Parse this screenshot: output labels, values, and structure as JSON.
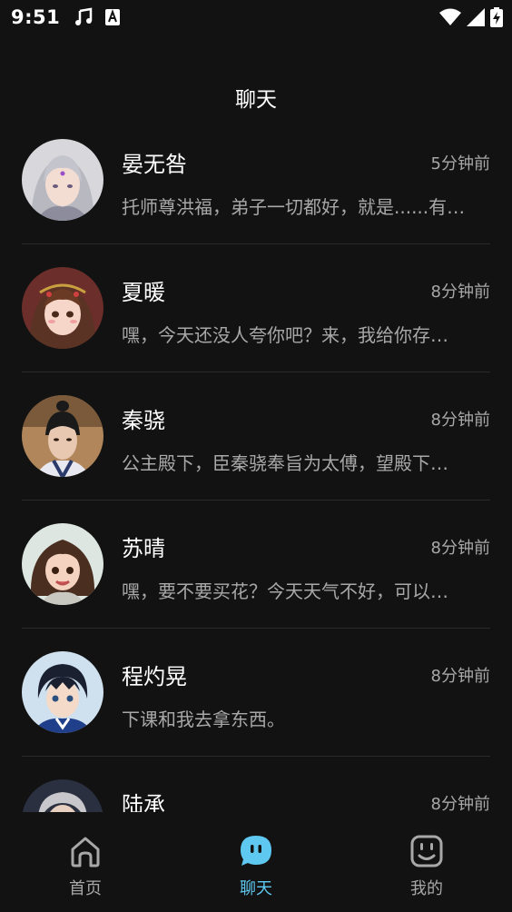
{
  "status": {
    "time": "9:51",
    "icons": [
      "music-note-icon",
      "a-notification-icon",
      "wifi-icon",
      "signal-icon",
      "battery-charging-icon"
    ]
  },
  "page": {
    "title": "聊天"
  },
  "chats": [
    {
      "name": "晏无咎",
      "time": "5分钟前",
      "preview": "托师尊洪福，弟子一切都好，就是......有…"
    },
    {
      "name": "夏暖",
      "time": "8分钟前",
      "preview": "嘿，今天还没人夸你吧？来，我给你存…"
    },
    {
      "name": "秦骁",
      "time": "8分钟前",
      "preview": "公主殿下，臣秦骁奉旨为太傅，望殿下…"
    },
    {
      "name": "苏晴",
      "time": "8分钟前",
      "preview": "嘿，要不要买花？今天天气不好，可以…"
    },
    {
      "name": "程灼晃",
      "time": "8分钟前",
      "preview": "下课和我去拿东西。"
    },
    {
      "name": "陆承",
      "time": "8分钟前",
      "preview": ""
    }
  ],
  "nav": {
    "home": "首页",
    "chat": "聊天",
    "mine": "我的",
    "active_color": "#5ec8f0"
  }
}
